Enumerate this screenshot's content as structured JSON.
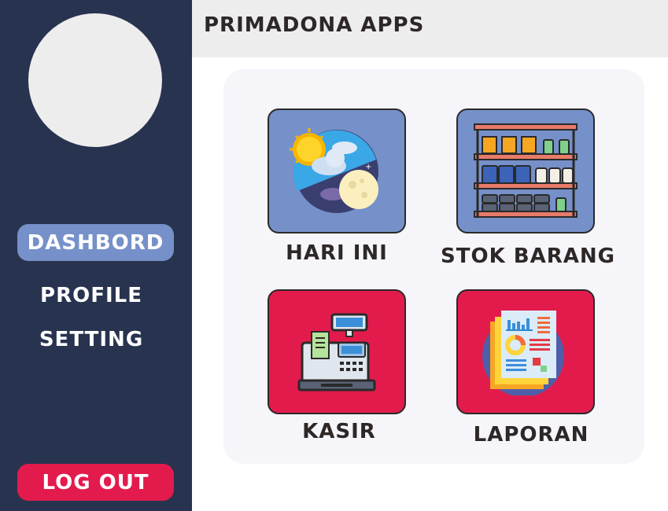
{
  "app": {
    "title": "PRIMADONA APPS"
  },
  "sidebar": {
    "items": [
      {
        "label": "DASHBORD",
        "active": true
      },
      {
        "label": "PROFILE",
        "active": false
      },
      {
        "label": "SETTING",
        "active": false
      }
    ],
    "logout_label": "LOG OUT"
  },
  "menu": {
    "tiles": [
      {
        "label": "HARI INI",
        "icon": "day-night-icon"
      },
      {
        "label": "STOK BARANG",
        "icon": "shelf-icon"
      },
      {
        "label": "KASIR",
        "icon": "cash-register-icon"
      },
      {
        "label": "LAPORAN",
        "icon": "report-icon"
      }
    ]
  },
  "colors": {
    "sidebar": "#283350",
    "accent_blue": "#7690c9",
    "accent_red": "#e31b4d",
    "header": "#ededed",
    "panel": "#f5f5fa",
    "text_dark": "#2e2727"
  }
}
